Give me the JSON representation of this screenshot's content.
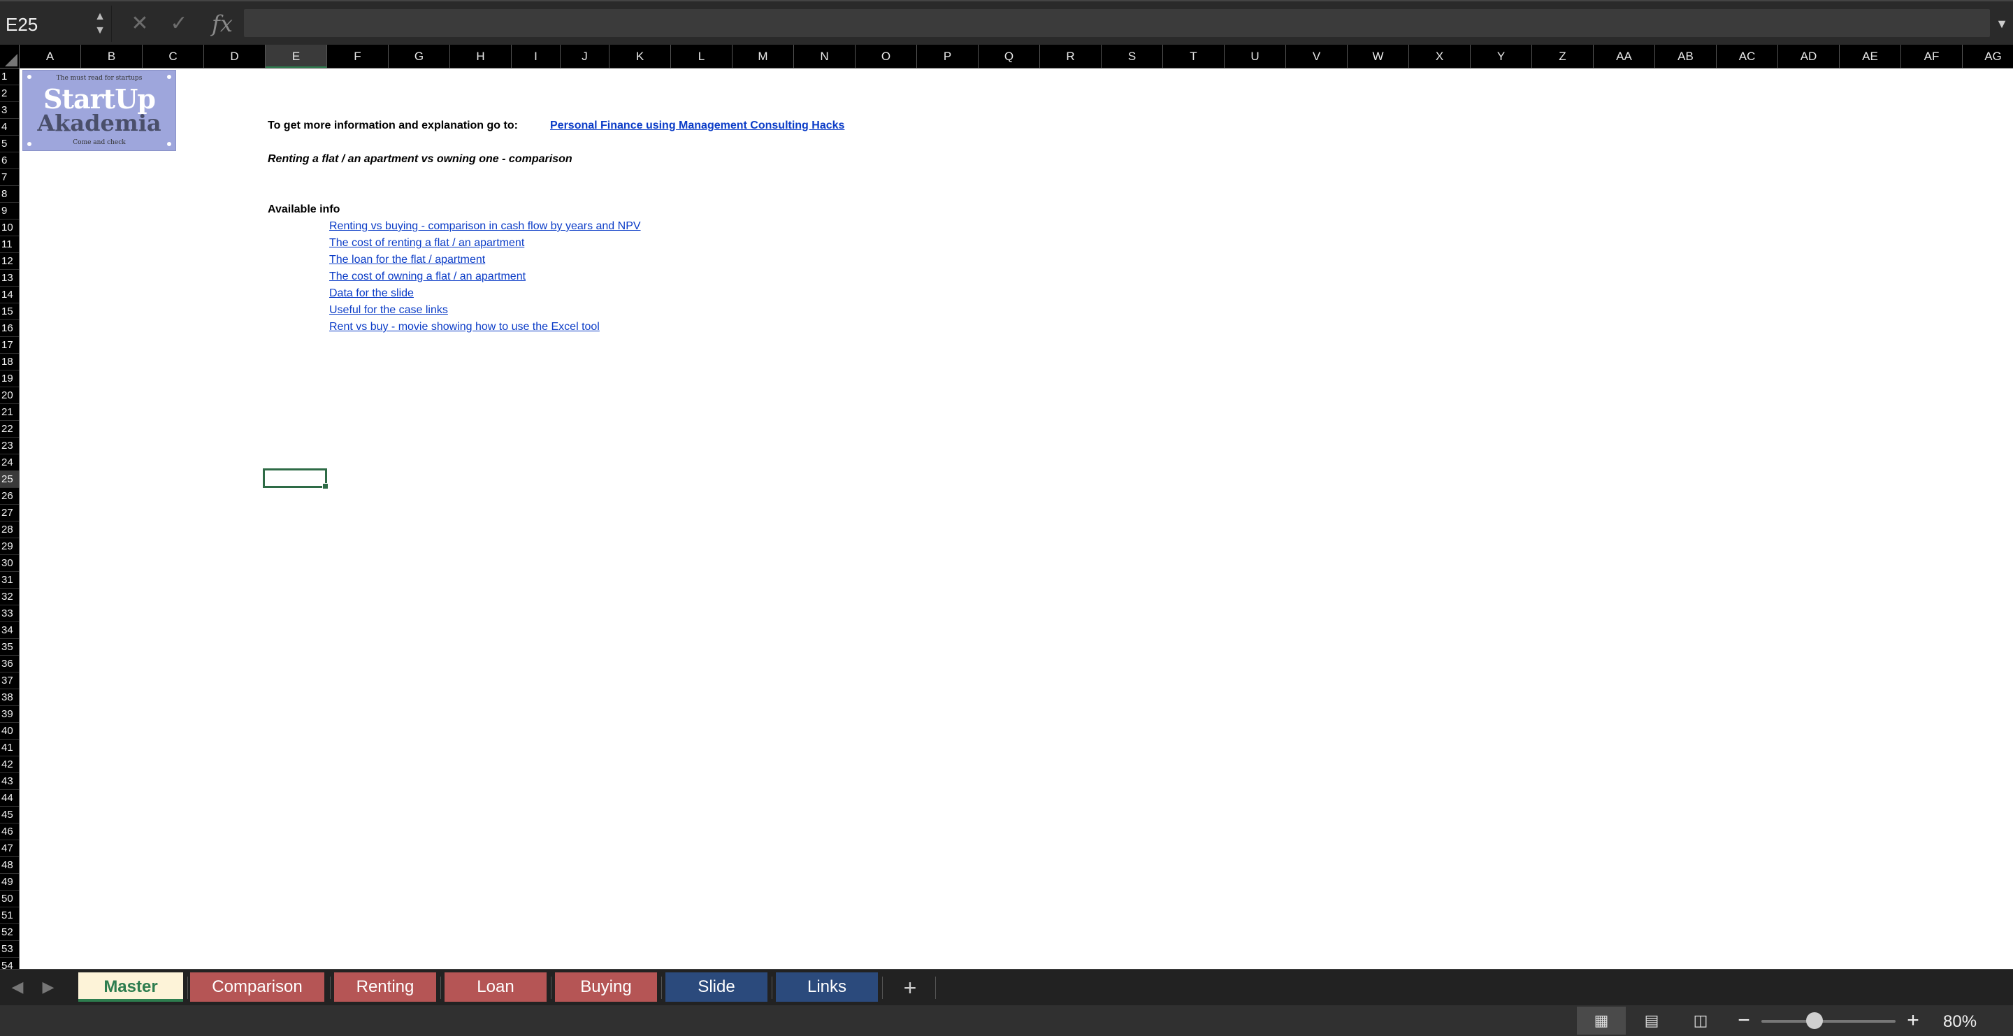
{
  "formula_bar": {
    "name_box": "E25",
    "formula": ""
  },
  "columns": [
    "A",
    "B",
    "C",
    "D",
    "E",
    "F",
    "G",
    "H",
    "I",
    "J",
    "K",
    "L",
    "M",
    "N",
    "O",
    "P",
    "Q",
    "R",
    "S",
    "T",
    "U",
    "V",
    "W",
    "X",
    "Y",
    "Z",
    "AA",
    "AB",
    "AC",
    "AD",
    "AE",
    "AF",
    "AG"
  ],
  "active_column": "E",
  "rows": [
    "1",
    "2",
    "3",
    "4",
    "5",
    "6",
    "7",
    "8",
    "9",
    "10",
    "11",
    "12",
    "13",
    "14",
    "15",
    "16",
    "17",
    "18",
    "19",
    "20",
    "21",
    "22",
    "23",
    "24",
    "25",
    "26",
    "27",
    "28",
    "29",
    "30",
    "31",
    "32",
    "33",
    "34",
    "35",
    "36",
    "37",
    "38",
    "39",
    "40",
    "41",
    "42",
    "43",
    "44",
    "45",
    "46",
    "47",
    "48",
    "49",
    "50",
    "51",
    "52",
    "53",
    "54"
  ],
  "active_row": "25",
  "logo": {
    "tagline": "The must read for startups",
    "line1": "StartUp",
    "line2": "Akademia",
    "footer": "Come and check"
  },
  "content": {
    "info_label": "To get more information and explanation go to:",
    "info_link": "Personal Finance using Management Consulting Hacks",
    "subtitle": "Renting a flat / an apartment vs owning one - comparison",
    "available_label": "Available info",
    "links": [
      "Renting vs buying - comparison  in cash flow by years and NPV",
      "The cost of renting a flat / an apartment",
      "The loan for the flat / apartment",
      "The cost of owning a flat / an apartment",
      "Data for the slide",
      "Useful for the case links",
      "Rent vs buy - movie showing how to use the Excel tool"
    ]
  },
  "sheet_tabs": [
    {
      "label": "Master",
      "color": "#fdf3d8",
      "active": true
    },
    {
      "label": "Comparison",
      "color": "#b55555"
    },
    {
      "label": "Renting",
      "color": "#b55555"
    },
    {
      "label": "Loan",
      "color": "#b55555"
    },
    {
      "label": "Buying",
      "color": "#b55555"
    },
    {
      "label": "Slide",
      "color": "#2b4a7c"
    },
    {
      "label": "Links",
      "color": "#2b4a7c"
    }
  ],
  "status_bar": {
    "zoom": "80%",
    "zoom_level_percent": 80
  }
}
